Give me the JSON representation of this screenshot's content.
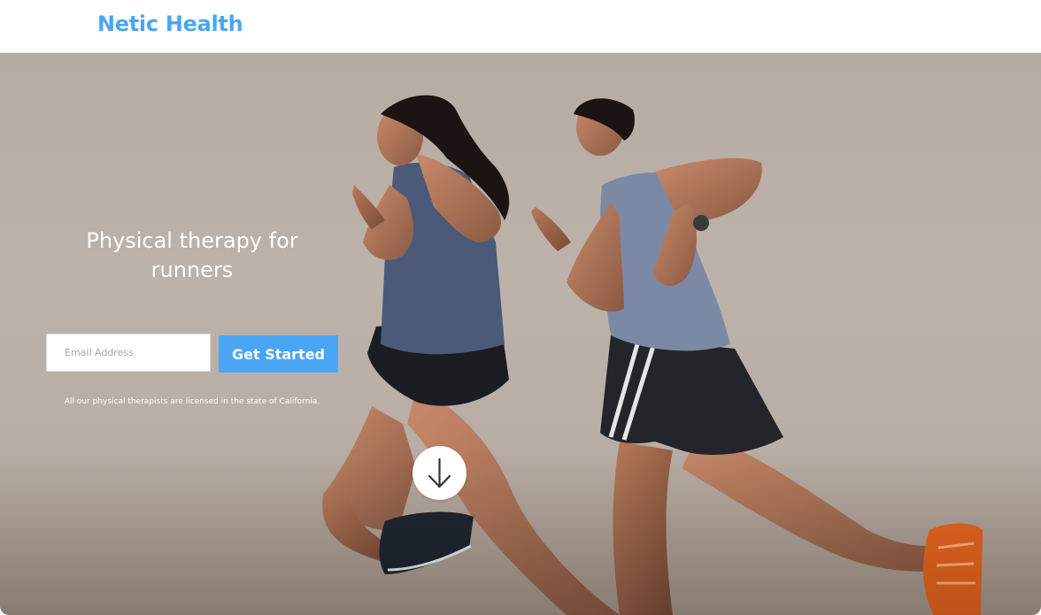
{
  "brand": {
    "name": "Netic Health",
    "color": "#4aa6f5"
  },
  "hero": {
    "headline": "Physical therapy for runners",
    "email_placeholder": "Email Address",
    "cta_label": "Get Started",
    "disclaimer": "All our physical therapists are licensed in the state of California.",
    "scroll_icon": "arrow-down-icon",
    "image_subject": "two-runners-photo"
  }
}
